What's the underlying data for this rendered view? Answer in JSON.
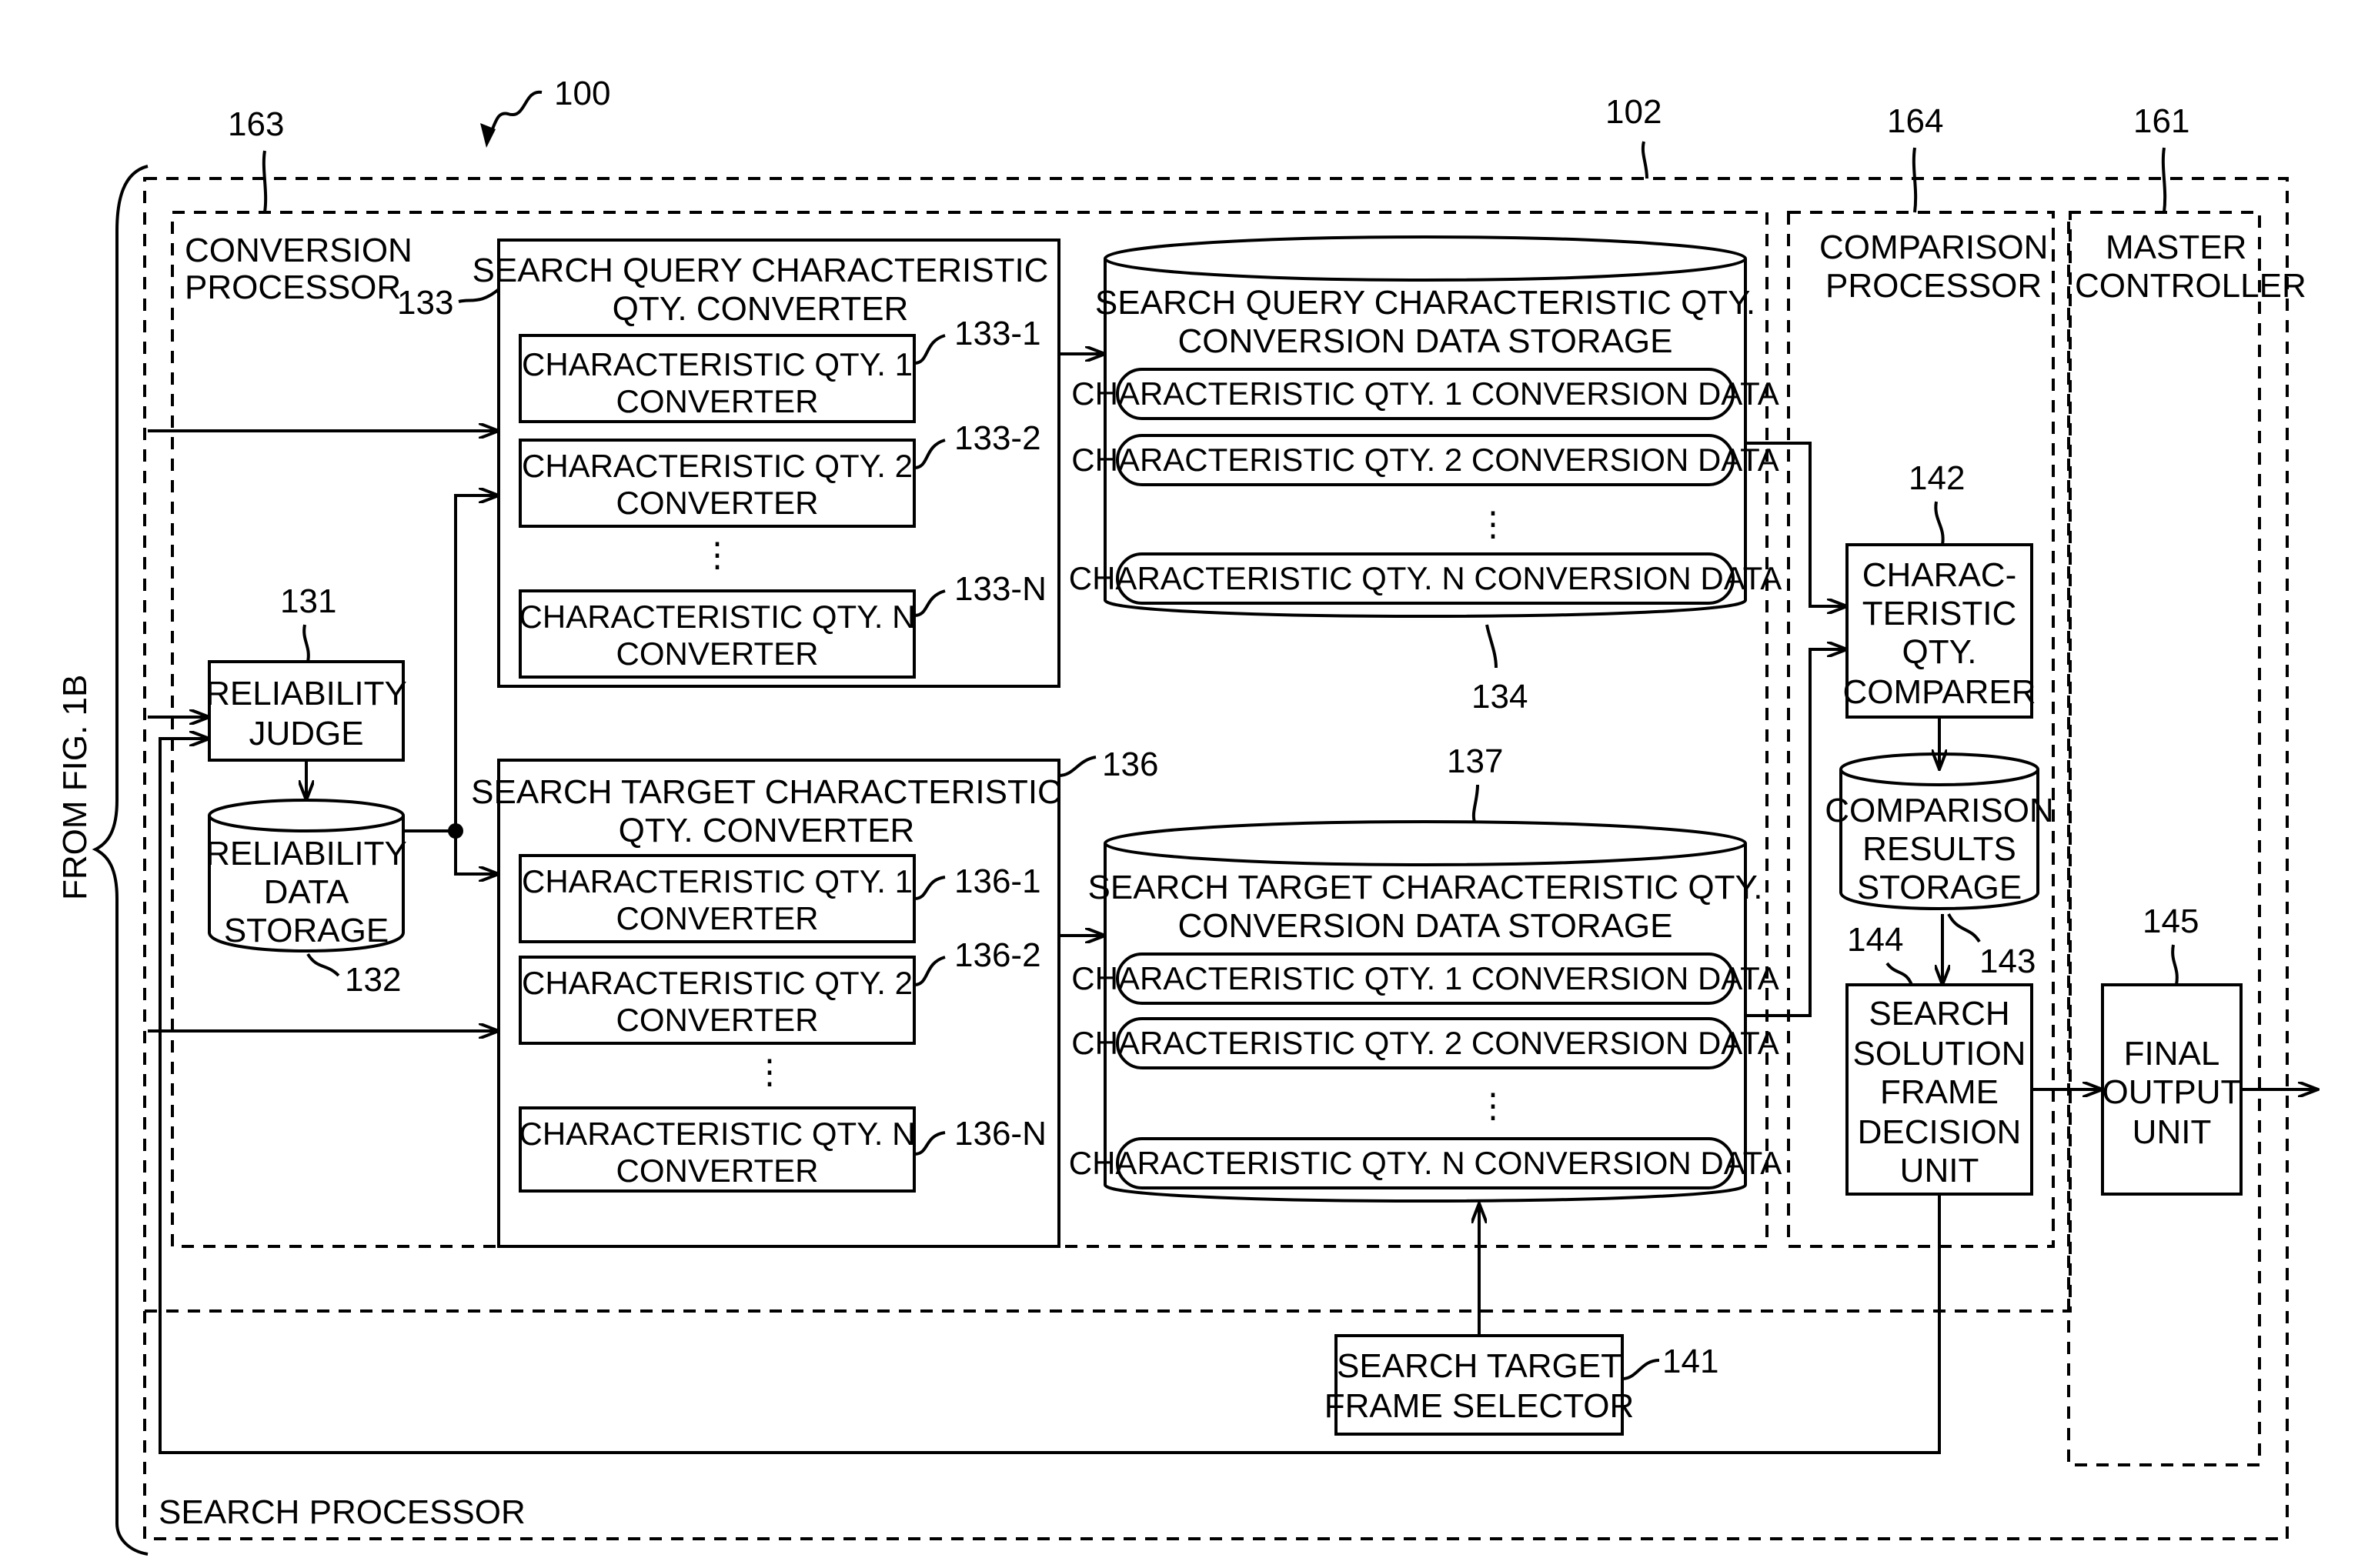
{
  "figure": {
    "ref_system": "100",
    "ref_search_processor": "102",
    "ref_conversion_processor": "163",
    "ref_comparison_processor": "164",
    "ref_master_controller": "161",
    "from_fig": "FROM FIG. 1B",
    "search_processor_label": "SEARCH PROCESSOR"
  },
  "conversion_processor": {
    "line1": "CONVERSION",
    "line2": "PROCESSOR"
  },
  "comparison_processor": {
    "line1": "COMPARISON",
    "line2": "PROCESSOR"
  },
  "master_controller": {
    "line1": "MASTER",
    "line2": "CONTROLLER"
  },
  "query_converter": {
    "ref": "133",
    "line1": "SEARCH QUERY CHARACTERISTIC",
    "line2": "QTY. CONVERTER",
    "items": [
      {
        "ref": "133-1",
        "line1": "CHARACTERISTIC QTY. 1",
        "line2": "CONVERTER"
      },
      {
        "ref": "133-2",
        "line1": "CHARACTERISTIC QTY. 2",
        "line2": "CONVERTER"
      },
      {
        "ref": "133-N",
        "line1": "CHARACTERISTIC QTY. N",
        "line2": "CONVERTER"
      }
    ]
  },
  "target_converter": {
    "ref": "136",
    "line1": "SEARCH TARGET CHARACTERISTIC",
    "line2": "QTY. CONVERTER",
    "items": [
      {
        "ref": "136-1",
        "line1": "CHARACTERISTIC QTY. 1",
        "line2": "CONVERTER"
      },
      {
        "ref": "136-2",
        "line1": "CHARACTERISTIC QTY. 2",
        "line2": "CONVERTER"
      },
      {
        "ref": "136-N",
        "line1": "CHARACTERISTIC QTY. N",
        "line2": "CONVERTER"
      }
    ]
  },
  "query_storage": {
    "ref": "134",
    "line1": "SEARCH QUERY CHARACTERISTIC QTY.",
    "line2": "CONVERSION DATA STORAGE",
    "items": [
      "CHARACTERISTIC QTY. 1 CONVERSION DATA",
      "CHARACTERISTIC QTY. 2 CONVERSION DATA",
      "CHARACTERISTIC QTY. N CONVERSION DATA"
    ]
  },
  "target_storage": {
    "ref": "137",
    "line1": "SEARCH TARGET CHARACTERISTIC QTY.",
    "line2": "CONVERSION DATA STORAGE",
    "items": [
      "CHARACTERISTIC QTY. 1 CONVERSION DATA",
      "CHARACTERISTIC QTY. 2 CONVERSION DATA",
      "CHARACTERISTIC QTY. N CONVERSION DATA"
    ]
  },
  "reliability_judge": {
    "ref": "131",
    "line1": "RELIABILITY",
    "line2": "JUDGE"
  },
  "reliability_storage": {
    "ref": "132",
    "line1": "RELIABILITY",
    "line2": "DATA",
    "line3": "STORAGE"
  },
  "comparer": {
    "ref": "142",
    "lines": [
      "CHARAC-",
      "TERISTIC",
      "QTY.",
      "COMPARER"
    ]
  },
  "comparison_storage": {
    "ref": "143",
    "lines": [
      "COMPARISON",
      "RESULTS",
      "STORAGE"
    ]
  },
  "decision_unit": {
    "ref": "144",
    "lines": [
      "SEARCH",
      "SOLUTION",
      "FRAME",
      "DECISION",
      "UNIT"
    ]
  },
  "final_output": {
    "ref": "145",
    "lines": [
      "FINAL",
      "OUTPUT",
      "UNIT"
    ]
  },
  "frame_selector": {
    "ref": "141",
    "line1": "SEARCH TARGET",
    "line2": "FRAME SELECTOR"
  },
  "ellipsis": "⋮"
}
